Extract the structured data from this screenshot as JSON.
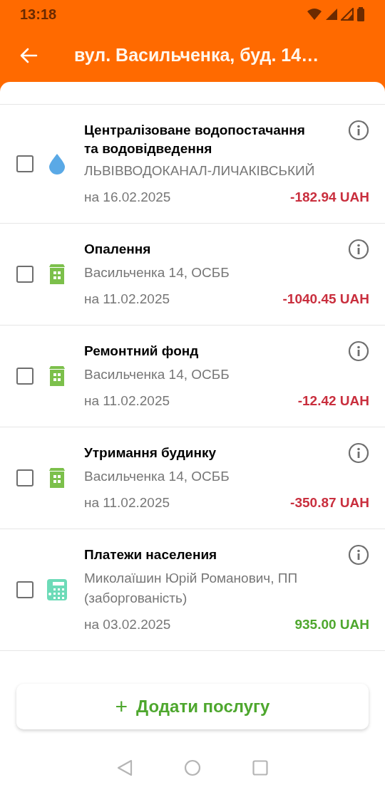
{
  "status_bar": {
    "time": "13:18"
  },
  "app_bar": {
    "title": "вул. Васильченка, буд. 14…"
  },
  "services": [
    {
      "kind": "water",
      "checked": false,
      "title": "Централізоване водопостачання та водовідведення",
      "provider": "ЛЬВІВВОДОКАНАЛ-ЛИЧАКІВСЬКИЙ",
      "date": "на 16.02.2025",
      "amount": "-182.94 UAH",
      "negative": true
    },
    {
      "kind": "building",
      "checked": false,
      "title": "Опалення",
      "provider": "Васильченка 14, ОСББ",
      "date": "на 11.02.2025",
      "amount": "-1040.45 UAH",
      "negative": true
    },
    {
      "kind": "building",
      "checked": false,
      "title": "Ремонтний фонд",
      "provider": "Васильченка 14, ОСББ",
      "date": "на 11.02.2025",
      "amount": "-12.42 UAH",
      "negative": true
    },
    {
      "kind": "building",
      "checked": false,
      "title": "Утримання будинку",
      "provider": "Васильченка 14, ОСББ",
      "date": "на 11.02.2025",
      "amount": "-350.87 UAH",
      "negative": true
    },
    {
      "kind": "calculator",
      "checked": false,
      "title": "Платежи населения",
      "provider": "Миколаїшин Юрій Романович, ПП (заборгованість)",
      "date": "на 03.02.2025",
      "amount": "935.00 UAH",
      "negative": false
    }
  ],
  "add_button": {
    "icon": "+",
    "label": "Додати послугу"
  }
}
